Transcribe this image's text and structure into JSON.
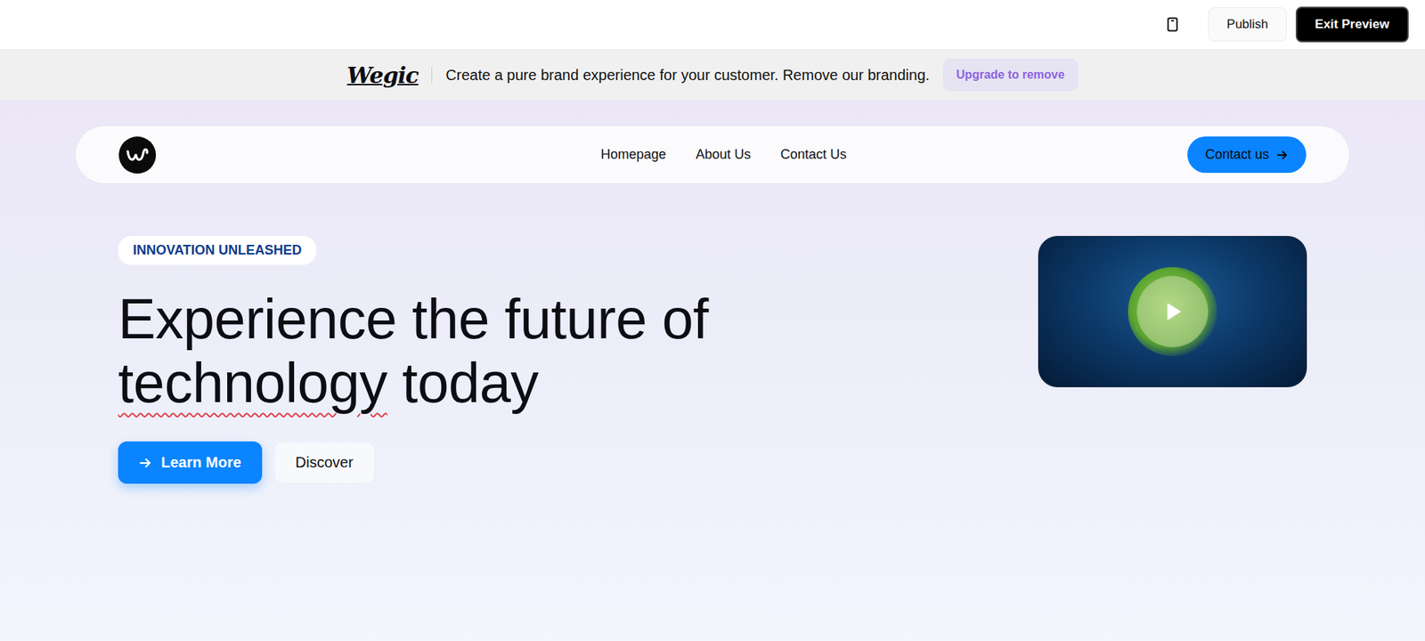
{
  "toolbar": {
    "buttons": [
      {
        "label": "Publish",
        "kind": "secondary"
      },
      {
        "label": "Exit Preview",
        "kind": "primary"
      }
    ]
  },
  "banner": {
    "logo": "Wegic",
    "message": "Create a pure brand experience for your customer. Remove our branding.",
    "button": "Upgrade to remove"
  },
  "nav": {
    "links": [
      "Homepage",
      "About Us",
      "Contact Us"
    ],
    "cta": "Contact us"
  },
  "hero": {
    "badge": "INNOVATION UNLEASHED",
    "title": [
      [
        {
          "text": "Experience the future of",
          "underlined": false
        }
      ],
      [
        {
          "text": "technology",
          "underlined": true
        },
        {
          "text": "today",
          "underlined": false
        }
      ]
    ],
    "buttons": [
      {
        "label": "Learn More",
        "kind": "primary"
      },
      {
        "label": "Discover",
        "kind": "secondary"
      }
    ]
  },
  "video": {
    "playing": false
  }
}
